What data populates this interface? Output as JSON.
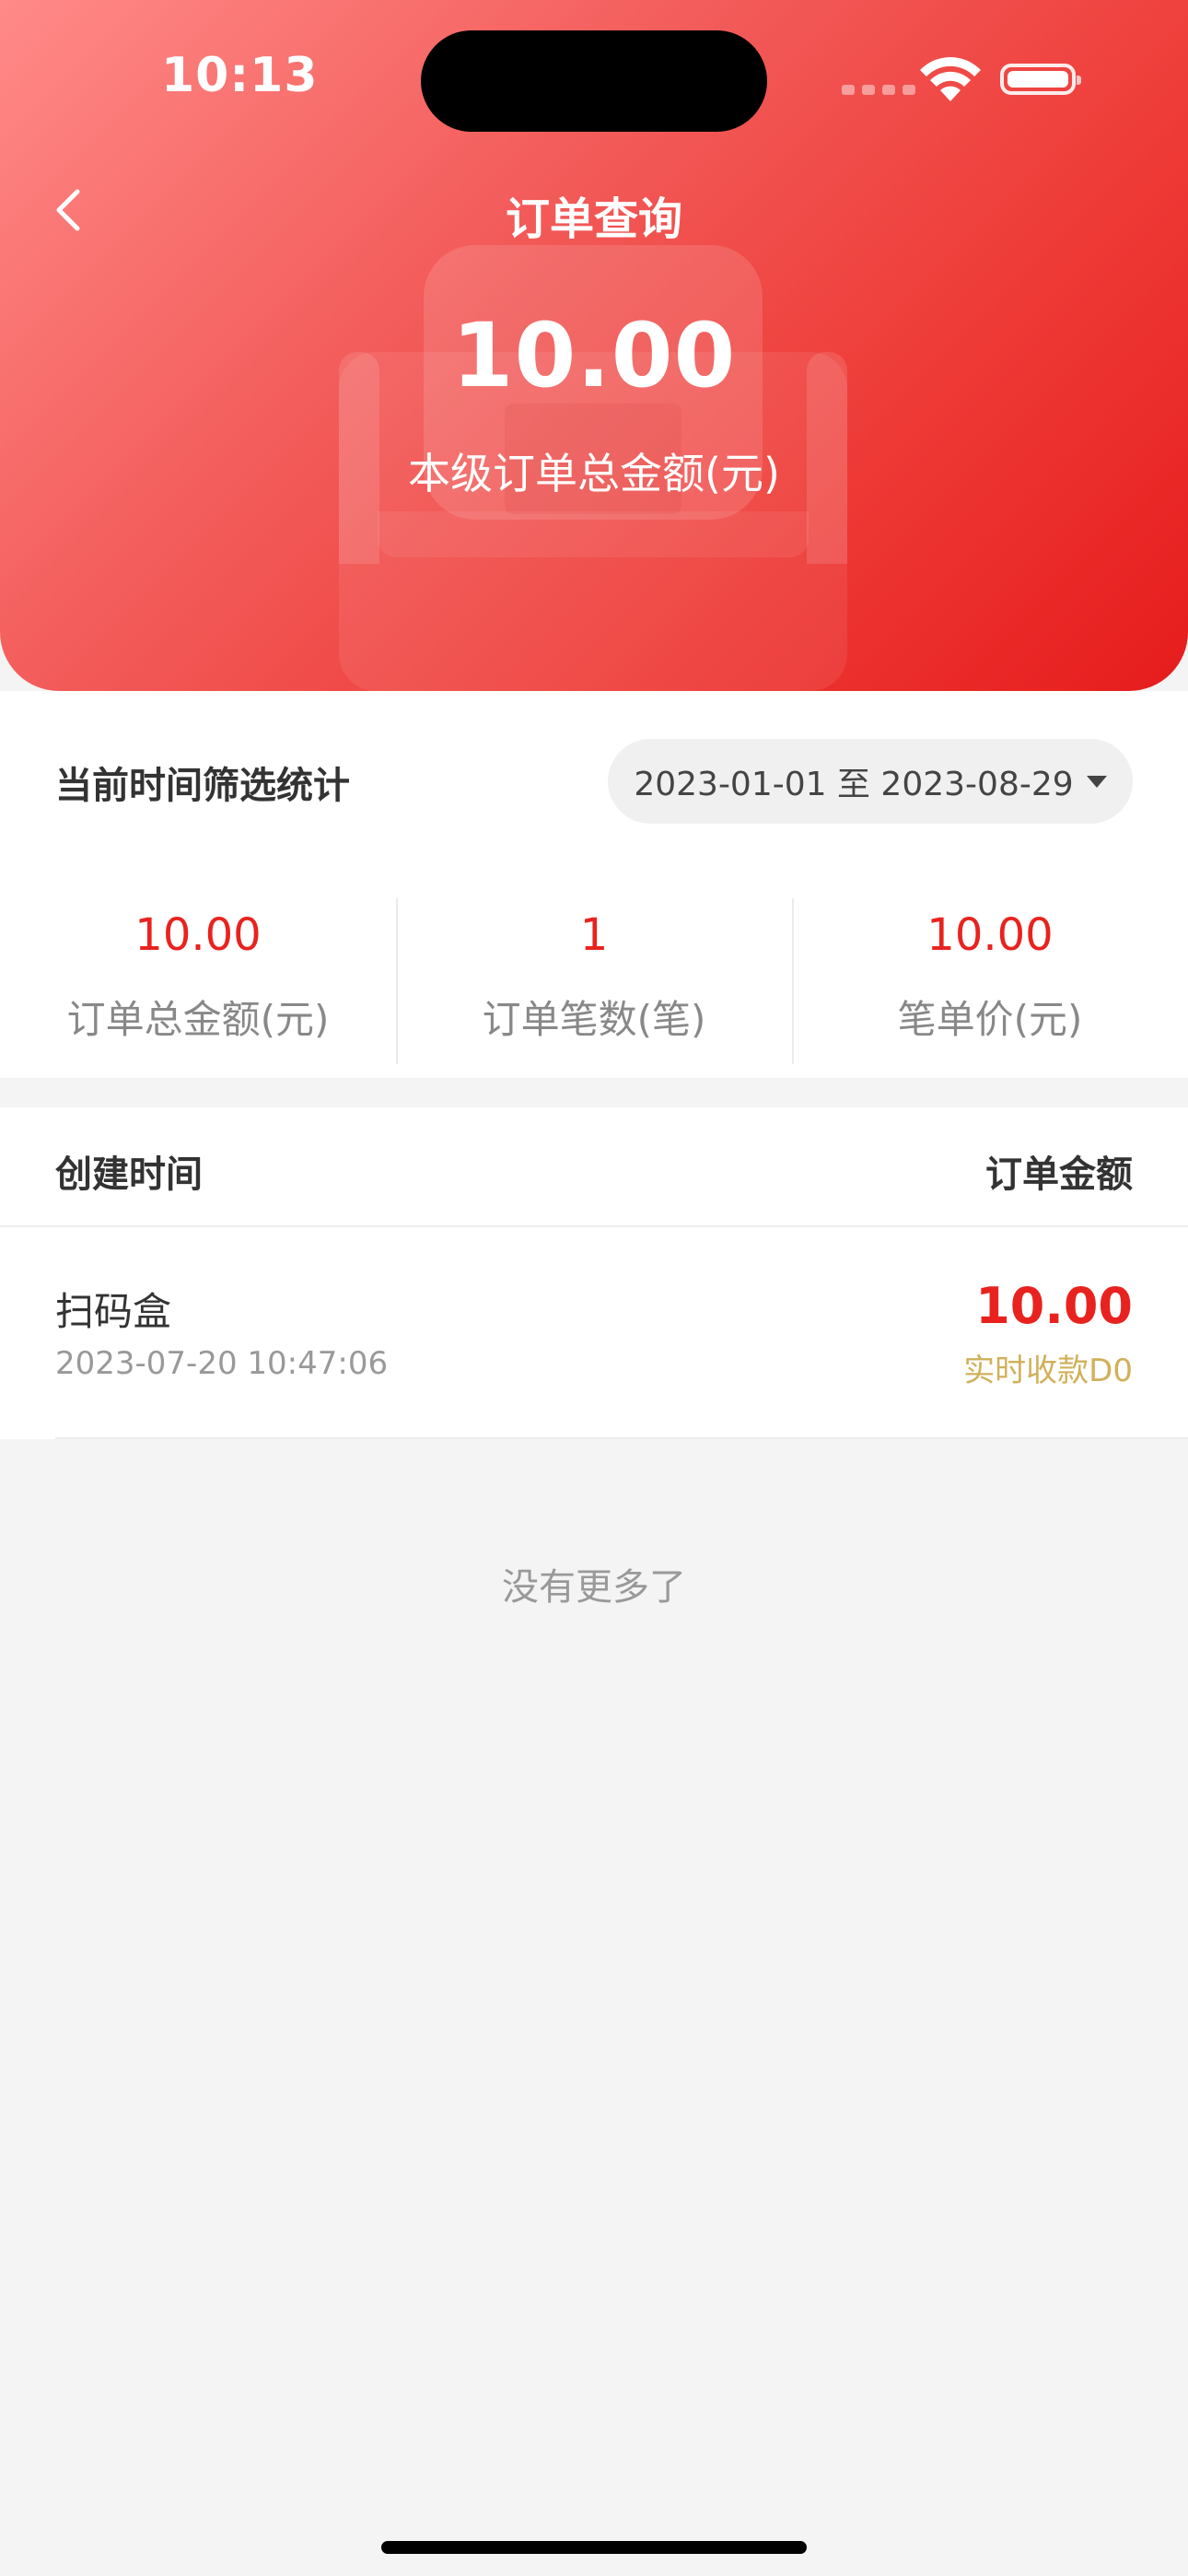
{
  "status_bar": {
    "time": "10:13"
  },
  "header": {
    "title": "订单查询",
    "total_amount": "10.00",
    "total_label": "本级订单总金额(元)"
  },
  "filter": {
    "title": "当前时间筛选统计",
    "date_range": "2023-01-01 至 2023-08-29"
  },
  "stats": [
    {
      "value": "10.00",
      "label": "订单总金额(元)"
    },
    {
      "value": "1",
      "label": "订单笔数(笔)"
    },
    {
      "value": "10.00",
      "label": "笔单价(元)"
    }
  ],
  "list": {
    "columns": {
      "left": "创建时间",
      "right": "订单金额"
    },
    "orders": [
      {
        "name": "扫码盒",
        "time": "2023-07-20 10:47:06",
        "amount": "10.00",
        "settle": "实时收款D0"
      }
    ],
    "no_more": "没有更多了"
  },
  "colors": {
    "accent_red": "#e8231f",
    "gold": "#d0b05a"
  }
}
